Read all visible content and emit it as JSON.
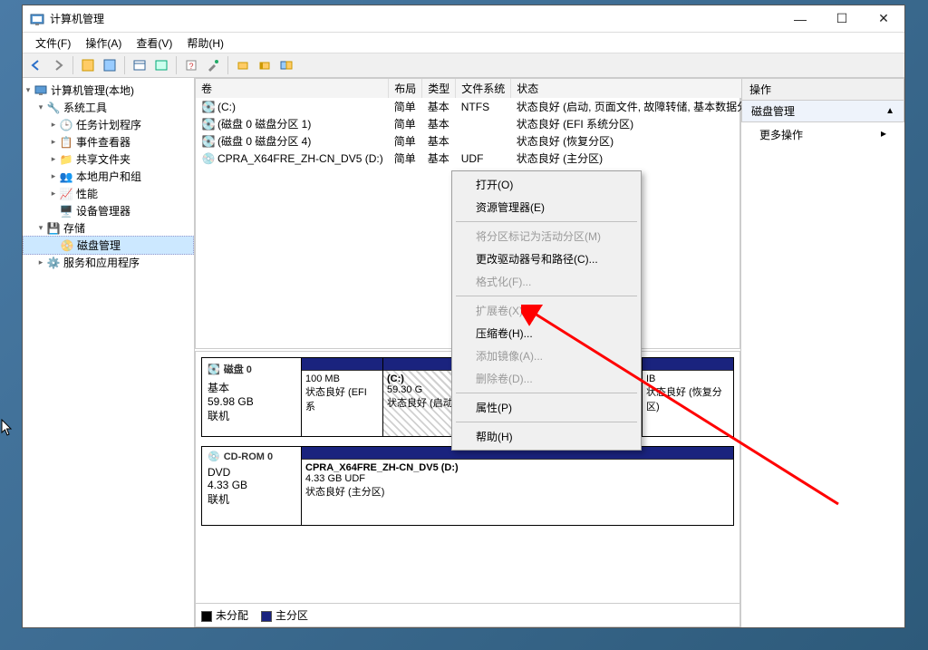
{
  "window": {
    "title": "计算机管理"
  },
  "menubar": [
    "文件(F)",
    "操作(A)",
    "查看(V)",
    "帮助(H)"
  ],
  "tree": {
    "root": "计算机管理(本地)",
    "g1": {
      "label": "系统工具",
      "items": [
        "任务计划程序",
        "事件查看器",
        "共享文件夹",
        "本地用户和组",
        "性能",
        "设备管理器"
      ]
    },
    "g2": {
      "label": "存储",
      "items": [
        "磁盘管理"
      ]
    },
    "g3": {
      "label": "服务和应用程序"
    }
  },
  "columns": [
    "卷",
    "布局",
    "类型",
    "文件系统",
    "状态"
  ],
  "volumes": [
    {
      "name": "(C:)",
      "layout": "简单",
      "type": "基本",
      "fs": "NTFS",
      "status": "状态良好 (启动, 页面文件, 故障转储, 基本数据分区"
    },
    {
      "name": "(磁盘 0 磁盘分区 1)",
      "layout": "简单",
      "type": "基本",
      "fs": "",
      "status": "状态良好 (EFI 系统分区)"
    },
    {
      "name": "(磁盘 0 磁盘分区 4)",
      "layout": "简单",
      "type": "基本",
      "fs": "",
      "status": "状态良好 (恢复分区)"
    },
    {
      "name": "CPRA_X64FRE_ZH-CN_DV5 (D:)",
      "layout": "简单",
      "type": "基本",
      "fs": "UDF",
      "status": "状态良好 (主分区)"
    }
  ],
  "disk0": {
    "title": "磁盘 0",
    "kind": "基本",
    "size": "59.98 GB",
    "state": "联机",
    "p1": {
      "size": "100 MB",
      "status": "状态良好 (EFI 系"
    },
    "p2": {
      "name": "(C:)",
      "size": "59.30 G",
      "status": "状态良好 (启动, 页面文件, 故障转储, 基本"
    },
    "p3": {
      "size": "IB",
      "status": "状态良好 (恢复分区)"
    }
  },
  "cdrom": {
    "title": "CD-ROM 0",
    "kind": "DVD",
    "size": "4.33 GB",
    "state": "联机",
    "p1": {
      "name": "CPRA_X64FRE_ZH-CN_DV5  (D:)",
      "size": "4.33 GB UDF",
      "status": "状态良好 (主分区)"
    }
  },
  "legend": {
    "unalloc": "未分配",
    "primary": "主分区"
  },
  "actions": {
    "header": "操作",
    "title": "磁盘管理",
    "more": "更多操作"
  },
  "ctx": {
    "open": "打开(O)",
    "explorer": "资源管理器(E)",
    "markactive": "将分区标记为活动分区(M)",
    "changeletter": "更改驱动器号和路径(C)...",
    "format": "格式化(F)...",
    "extend": "扩展卷(X)...",
    "shrink": "压缩卷(H)...",
    "addmirror": "添加镜像(A)...",
    "delete": "删除卷(D)...",
    "props": "属性(P)",
    "help": "帮助(H)"
  }
}
